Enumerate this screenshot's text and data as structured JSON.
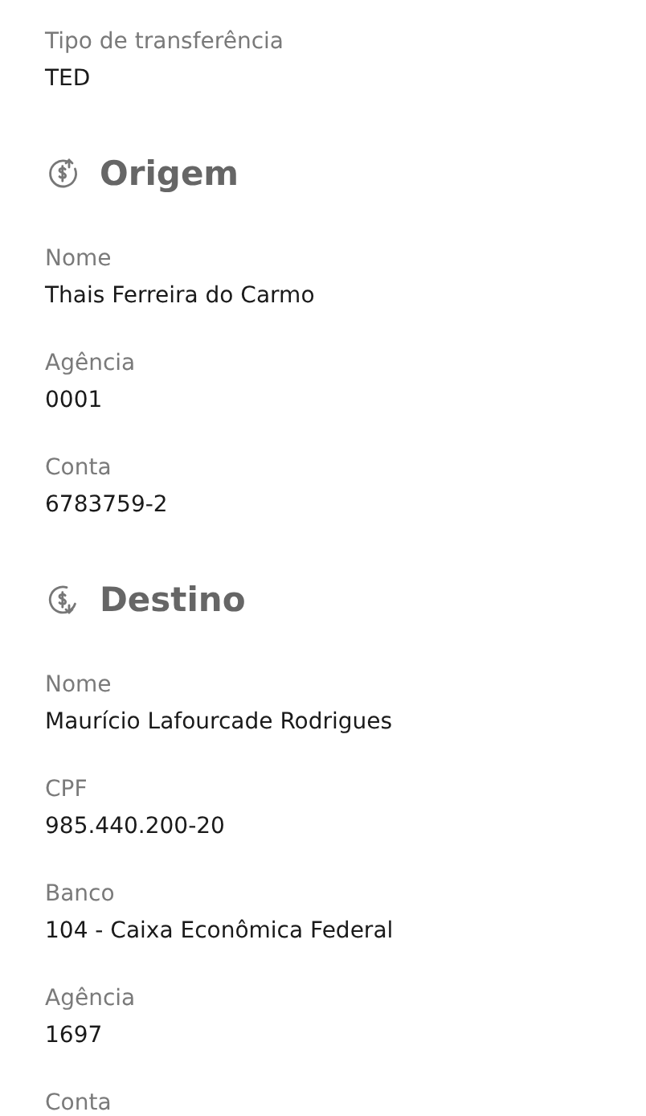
{
  "fields": [
    {
      "label": "Tipo de transferência",
      "value": "TED"
    }
  ],
  "sections": [
    {
      "title": "Origem",
      "kind": "outgoing",
      "fields": [
        {
          "label": "Nome",
          "value": "Thais Ferreira do Carmo"
        },
        {
          "label": "Agência",
          "value": "0001"
        },
        {
          "label": "Conta",
          "value": "6783759-2"
        }
      ]
    },
    {
      "title": "Destino",
      "kind": "incoming",
      "fields": [
        {
          "label": "Nome",
          "value": "Maurício Lafourcade Rodrigues"
        },
        {
          "label": "CPF",
          "value": "985.440.200-20"
        },
        {
          "label": "Banco",
          "value": "104 - Caixa Econômica Federal"
        },
        {
          "label": "Agência",
          "value": "1697"
        },
        {
          "label": "Conta"
        }
      ]
    }
  ]
}
